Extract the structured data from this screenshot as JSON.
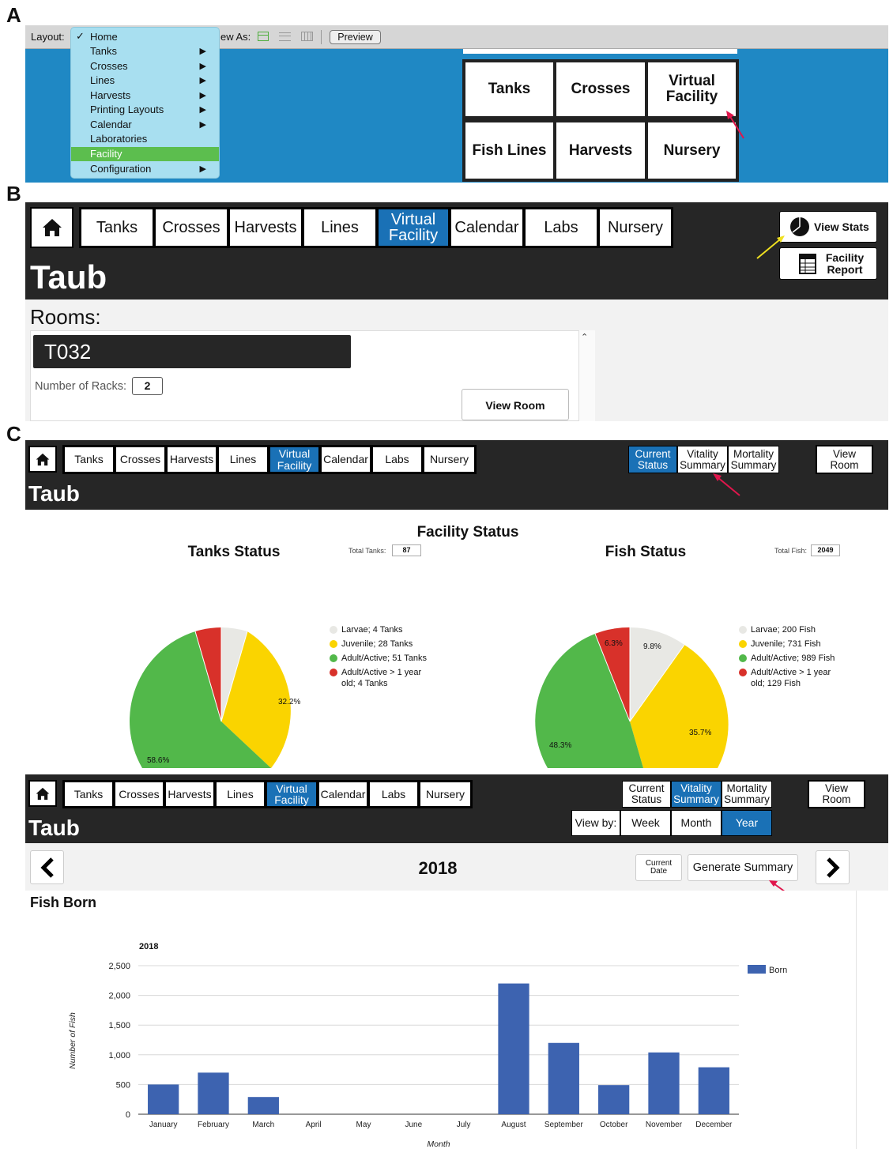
{
  "panel_labels": {
    "a": "A",
    "b": "B",
    "c": "C"
  },
  "panel_a": {
    "layout_label": "Layout:",
    "view_as_label": "ew As:",
    "preview_button": "Preview",
    "checkmark": "✓",
    "menu_items": [
      {
        "label": "Home",
        "submenu": false
      },
      {
        "label": "Tanks",
        "submenu": true
      },
      {
        "label": "Crosses",
        "submenu": true
      },
      {
        "label": "Lines",
        "submenu": true
      },
      {
        "label": "Harvests",
        "submenu": true
      },
      {
        "label": "Printing Layouts",
        "submenu": true
      },
      {
        "label": "Calendar",
        "submenu": true
      },
      {
        "label": "Laboratories",
        "submenu": false
      },
      {
        "label": "Facility",
        "submenu": false,
        "highlighted": true
      },
      {
        "label": "Configuration",
        "submenu": true
      }
    ],
    "tiles": [
      "Tanks",
      "Crosses",
      "Virtual Facility",
      "Fish Lines",
      "Harvests",
      "Nursery"
    ]
  },
  "nav_tabs": [
    "Tanks",
    "Crosses",
    "Harvests",
    "Lines",
    "Virtual Facility",
    "Calendar",
    "Labs",
    "Nursery"
  ],
  "panel_b": {
    "view_stats": "View Stats",
    "facility_report": "Facility Report",
    "facility_name": "Taub",
    "rooms_label": "Rooms:",
    "room_name": "T032",
    "racks_label": "Number of Racks:",
    "racks_value": "2",
    "view_room": "View Room"
  },
  "panel_c1": {
    "facility_name": "Taub",
    "summary_tabs": [
      "Current Status",
      "Vitality Summary",
      "Mortality Summary"
    ],
    "view_room": "View Room",
    "facility_status_title": "Facility Status",
    "tanks_title": "Tanks Status",
    "total_tanks_label": "Total Tanks:",
    "total_tanks": "87",
    "fish_title": "Fish Status",
    "total_fish_label": "Total Fish:",
    "total_fish": "2049",
    "tanks_legend": [
      "Larvae; 4 Tanks",
      "Juvenile; 28 Tanks",
      "Adult/Active; 51 Tanks",
      "Adult/Active > 1 year old; 4 Tanks"
    ],
    "fish_legend": [
      "Larvae; 200 Fish",
      "Juvenile; 731 Fish",
      "Adult/Active; 989 Fish",
      "Adult/Active > 1 year old; 129 Fish"
    ],
    "tanks_pie_labels": [
      "32.2%",
      "58.6%"
    ],
    "fish_pie_labels": [
      "9.8%",
      "35.7%",
      "48.3%",
      "6.3%"
    ],
    "colors": {
      "larvae": "#e8e8e4",
      "juvenile": "#fad400",
      "adult": "#52b84a",
      "adult_old": "#d8312a"
    }
  },
  "panel_c2": {
    "facility_name": "Taub",
    "summary_tabs": [
      "Current Status",
      "Vitality Summary",
      "Mortality Summary"
    ],
    "view_room": "View Room",
    "view_by_label": "View by:",
    "view_by_options": [
      "Week",
      "Month",
      "Year"
    ],
    "year": "2018",
    "current_date": "Current Date",
    "generate_summary": "Generate Summary",
    "section_title": "Fish Born"
  },
  "chart_data": {
    "type": "bar",
    "title": "2018",
    "xlabel": "Month",
    "ylabel": "Number of Fish",
    "categories": [
      "January",
      "February",
      "March",
      "April",
      "May",
      "June",
      "July",
      "August",
      "September",
      "October",
      "November",
      "December"
    ],
    "series": [
      {
        "name": "Born",
        "values": [
          500,
          700,
          290,
          0,
          0,
          0,
          0,
          2200,
          1200,
          490,
          1040,
          790
        ]
      }
    ],
    "yticks": [
      "0",
      "500",
      "1,000",
      "1,500",
      "2,000",
      "2,500"
    ],
    "ylim": [
      0,
      2500
    ],
    "grid": true,
    "legend": "top-right",
    "bar_color": "#3d63b0"
  }
}
